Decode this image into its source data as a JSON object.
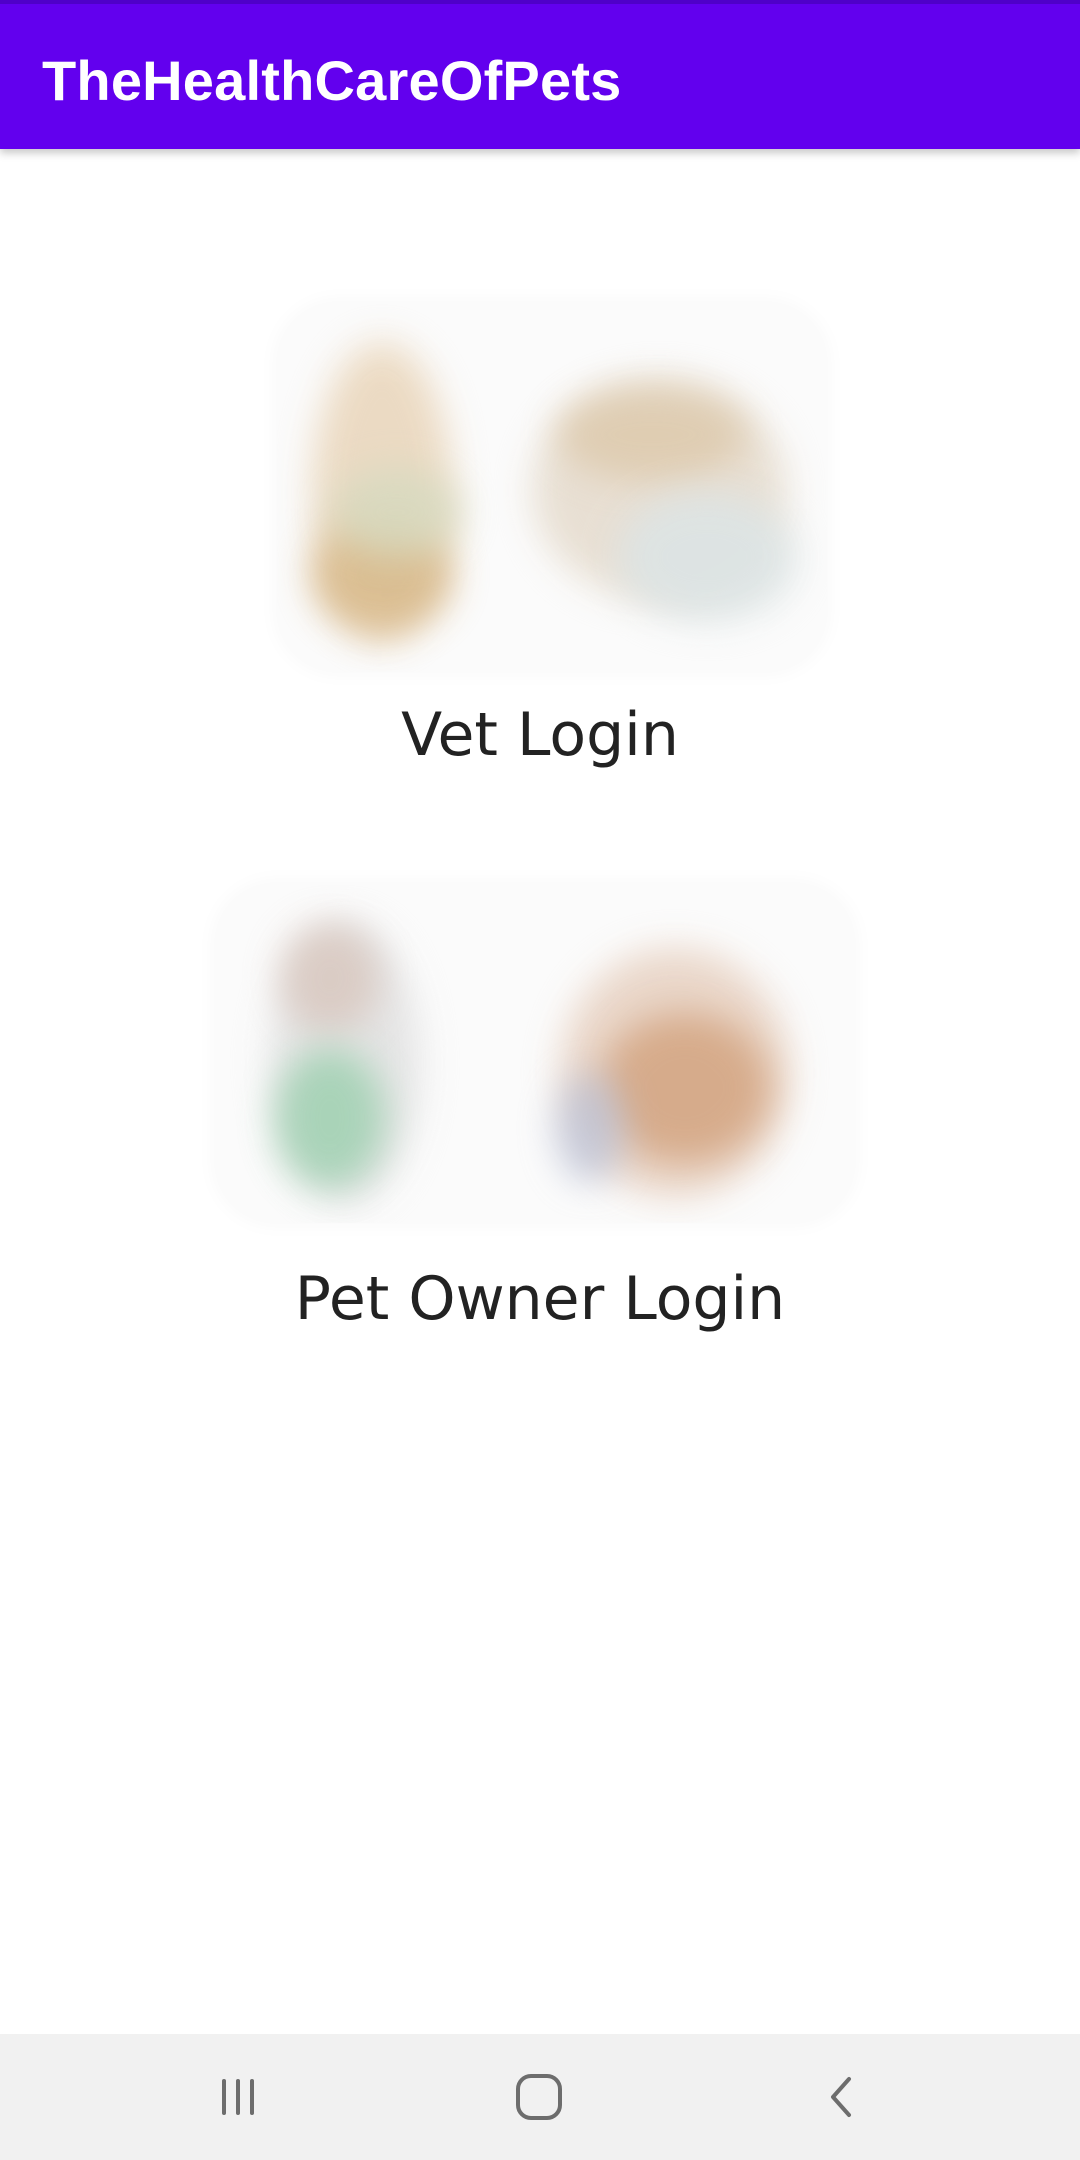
{
  "app_bar": {
    "title": "TheHealthCareOfPets",
    "color": "#6200ee"
  },
  "options": {
    "vet": {
      "label": "Vet Login",
      "image": "vet-pets-image"
    },
    "owner": {
      "label": "Pet Owner Login",
      "image": "pet-owner-pets-image"
    }
  },
  "nav_bar": {
    "recent": "recent-apps-icon",
    "home": "home-icon",
    "back": "back-icon",
    "background": "#f1f1f1"
  }
}
